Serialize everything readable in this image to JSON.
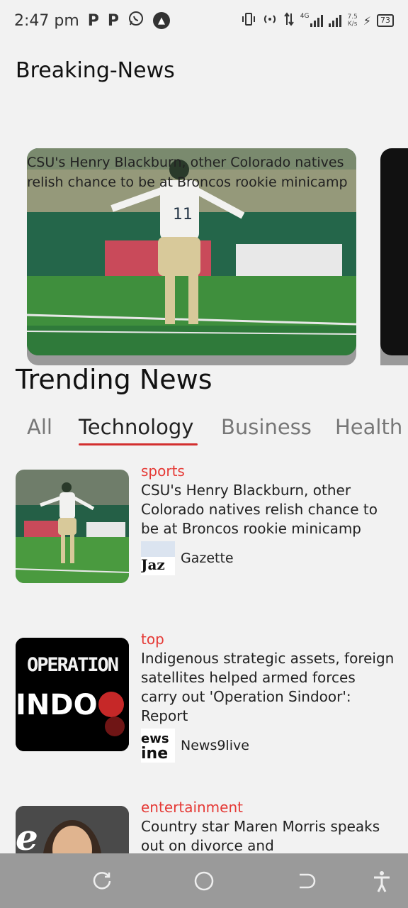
{
  "status_bar": {
    "time": "2:47 pm",
    "app_icons": [
      "P",
      "P"
    ],
    "network": "4G",
    "speed_value": "7.5",
    "speed_unit": "K/s",
    "battery": "73"
  },
  "header": {
    "title": "Breaking-News"
  },
  "carousel": {
    "items": [
      {
        "caption": "CSU's Henry Blackburn, other Colorado natives relish chance to be at Broncos rookie minicamp"
      }
    ]
  },
  "trending": {
    "title": "Trending News",
    "tabs": [
      "All",
      "Technology",
      "Business",
      "Health"
    ],
    "active_tab": "Technology"
  },
  "news": [
    {
      "category": "sports",
      "headline": "CSU's Henry Blackburn, other Colorado natives relish chance to be at Broncos rookie minicamp",
      "source": "Gazette",
      "thumb_icon": "football-player-image"
    },
    {
      "category": "top",
      "headline": "Indigenous strategic assets, foreign satellites helped armed forces carry out 'Operation Sindoor': Report",
      "source": "News9live",
      "thumb_text": "OPERATION",
      "thumb_text2": "INDO",
      "thumb_icon": "operation-sindoor-image"
    },
    {
      "category": "entertainment",
      "headline": "Country star Maren Morris speaks out on divorce and",
      "source": "",
      "thumb_icon": "portrait-image"
    }
  ],
  "colors": {
    "accent": "#d32f2f",
    "category": "#e53935",
    "background": "#f2f2f2",
    "navbar": "#9a9a9a"
  }
}
